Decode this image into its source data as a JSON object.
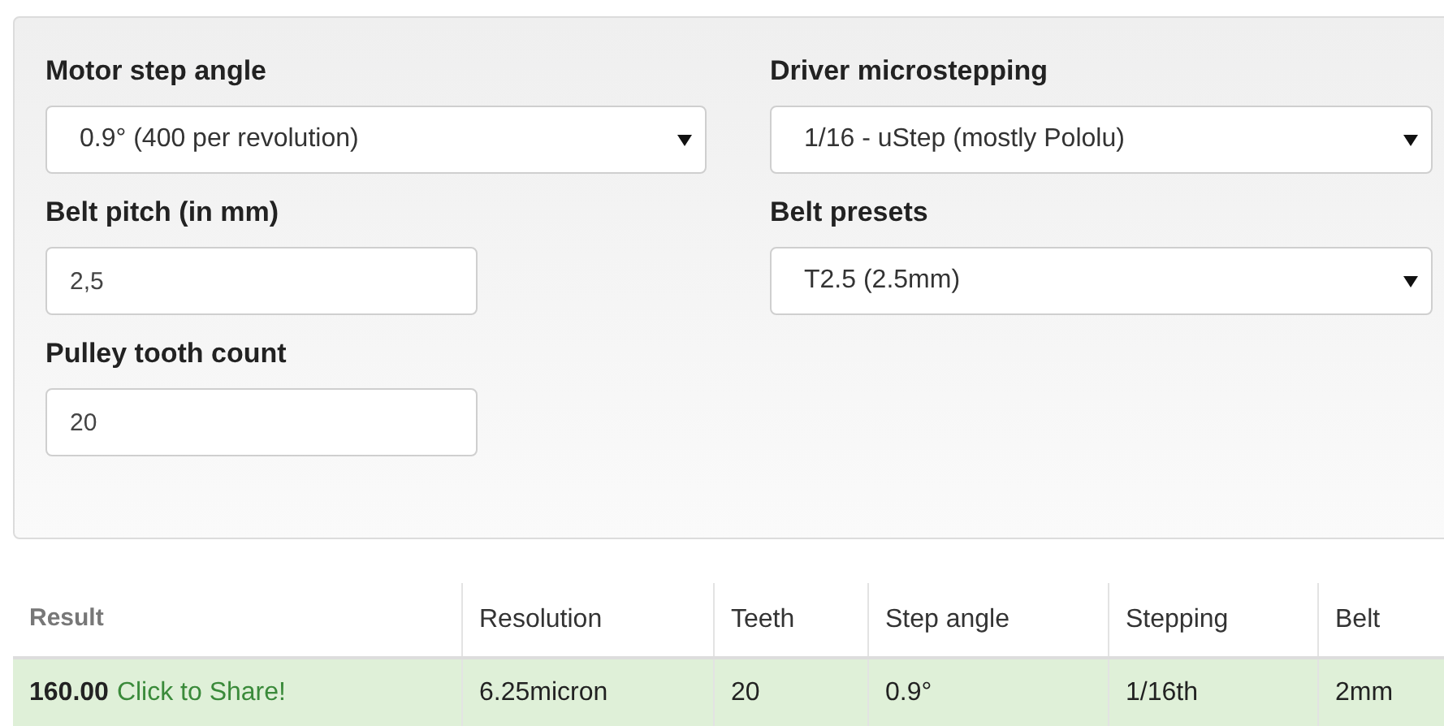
{
  "form": {
    "left_column": [
      {
        "kind": "select",
        "label": "Motor step angle",
        "value": "0.9° (400 per revolution)"
      },
      {
        "kind": "input",
        "label": "Belt pitch (in mm)",
        "value": "2,5"
      },
      {
        "kind": "input",
        "label": "Pulley tooth count",
        "value": "20"
      }
    ],
    "right_column": [
      {
        "kind": "select",
        "label": "Driver microstepping",
        "value": "1/16 - uStep (mostly Pololu)"
      },
      {
        "kind": "select",
        "label": "Belt presets",
        "value": "T2.5 (2.5mm)"
      }
    ]
  },
  "table": {
    "columns": [
      {
        "label": "Result",
        "emphasized": true
      },
      {
        "label": "Resolution",
        "emphasized": false
      },
      {
        "label": "Teeth",
        "emphasized": false
      },
      {
        "label": "Step angle",
        "emphasized": false
      },
      {
        "label": "Stepping",
        "emphasized": false
      },
      {
        "label": "Belt",
        "emphasized": false
      }
    ],
    "rows": [
      {
        "highlighted": true,
        "cells": [
          {
            "text": "160.00",
            "link": "Click to Share!"
          },
          {
            "text": "6.25micron"
          },
          {
            "text": "20"
          },
          {
            "text": "0.9°"
          },
          {
            "text": "1/16th"
          },
          {
            "text": "2mm"
          }
        ]
      }
    ]
  }
}
